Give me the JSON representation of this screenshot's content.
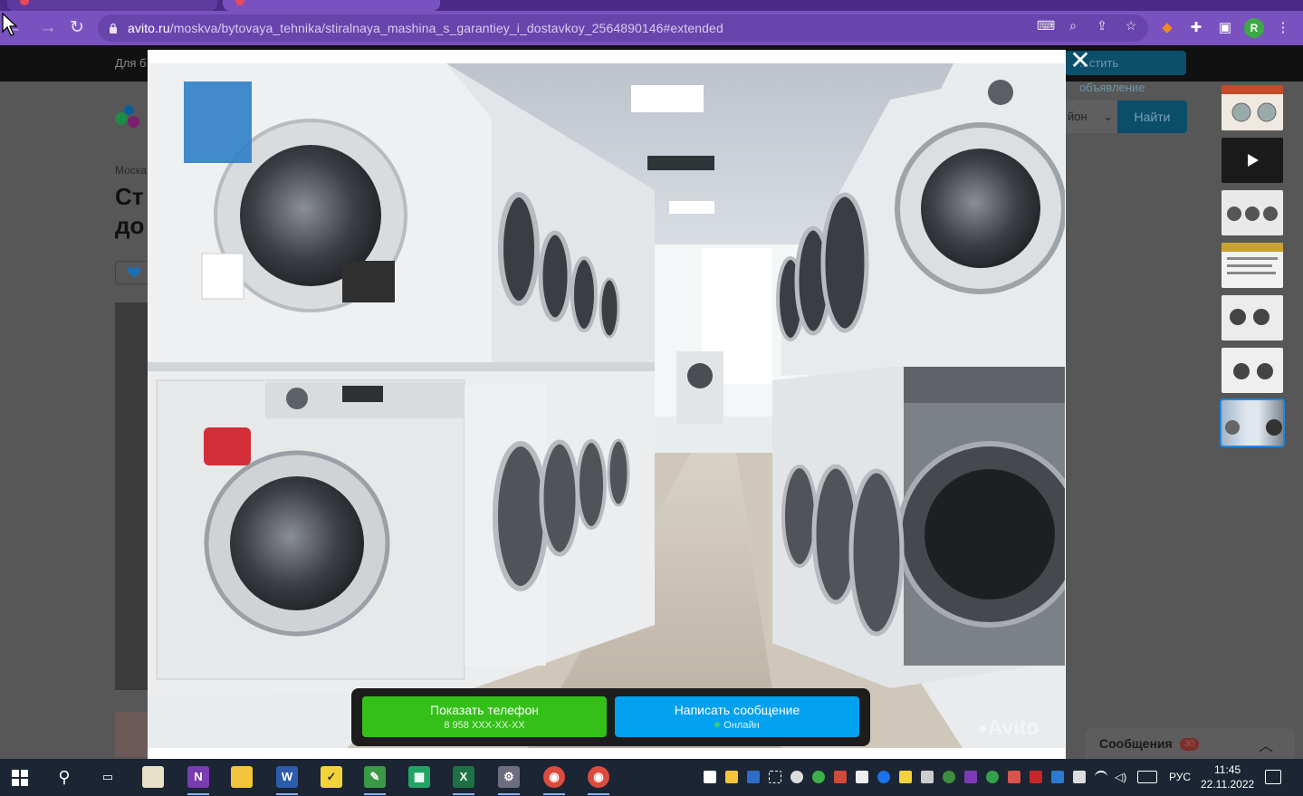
{
  "browser": {
    "url_host": "avito.ru",
    "url_path": "/moskva/bytovaya_tehnika/stiralnaya_mashina_s_garantiey_i_dostavkoy_2564890146#extended",
    "profile_initial": "R",
    "icons": [
      "back-icon",
      "forward-icon",
      "reload-icon",
      "lock-icon",
      "translate-icon",
      "zoom-icon",
      "share-icon",
      "bookmark-star-icon",
      "fox-extension-icon",
      "puzzle-extension-icon",
      "side-panel-icon",
      "menu-kebab-icon"
    ]
  },
  "page": {
    "topnav_left": "Для б",
    "post_button": "...стить объявление",
    "search_region": "йон",
    "search_button": "Найти",
    "breadcrumb": "Моска",
    "title_line1": "Ст",
    "title_line2": "до",
    "messages_label": "Сообщения",
    "messages_count": "30"
  },
  "lightbox": {
    "close_icon": "close-icon",
    "watermark": "Avito",
    "show_phone": "Показать телефон",
    "phone_masked": "8 958 XXX-XX-XX",
    "write_message": "Написать сообщение",
    "online_status": "Онлайн",
    "colors": {
      "green": "#34c019",
      "blue": "#02a1f0",
      "bar": "#1d1d1d"
    }
  },
  "thumbnails": [
    {
      "kind": "photo",
      "selected": false
    },
    {
      "kind": "video",
      "selected": false
    },
    {
      "kind": "photo",
      "selected": false
    },
    {
      "kind": "reviews",
      "selected": false
    },
    {
      "kind": "photo",
      "selected": false
    },
    {
      "kind": "photo",
      "selected": false
    },
    {
      "kind": "photo",
      "selected": true
    }
  ],
  "taskbar": {
    "language": "РУС",
    "time": "11:45",
    "date": "22.11.2022"
  }
}
